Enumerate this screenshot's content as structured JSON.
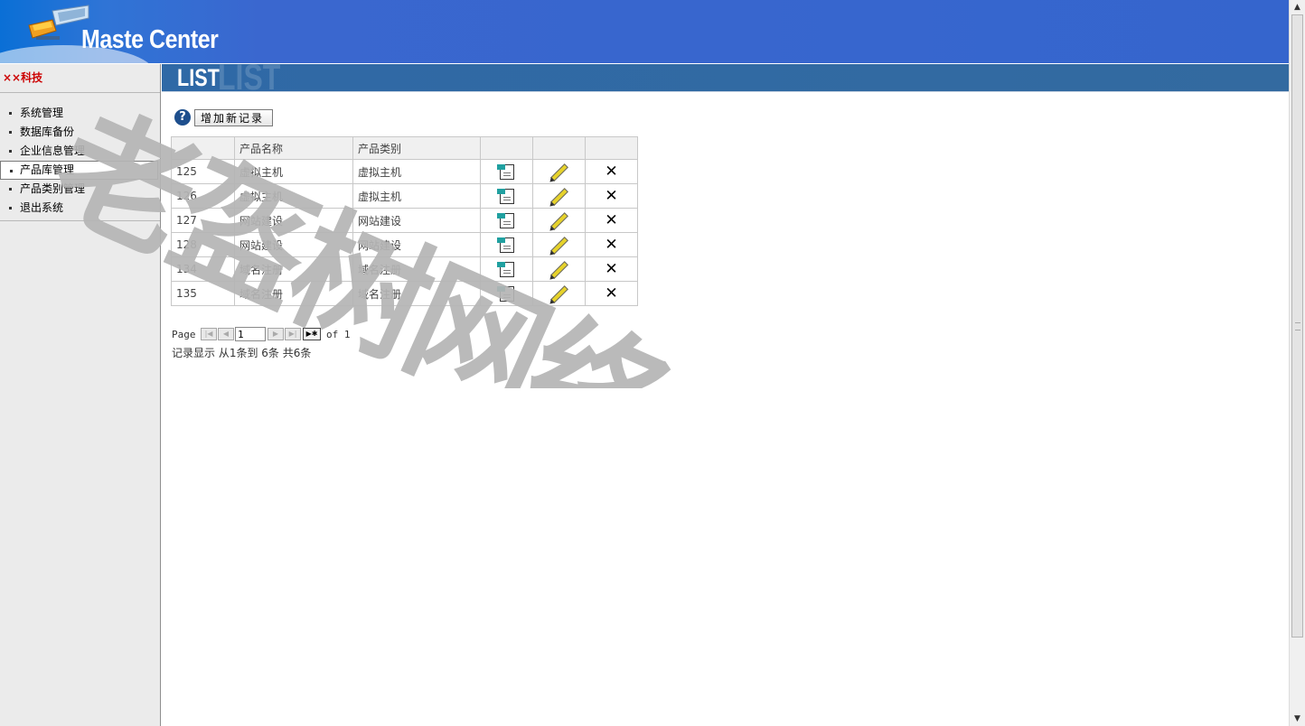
{
  "header": {
    "app_title": "Maste Center"
  },
  "sidebar": {
    "brand": "××科技",
    "items": [
      {
        "label": "系统管理",
        "active": false
      },
      {
        "label": "数据库备份",
        "active": false
      },
      {
        "label": "企业信息管理",
        "active": false
      },
      {
        "label": "产品库管理",
        "active": true
      },
      {
        "label": "产品类别管理",
        "active": false
      },
      {
        "label": "退出系统",
        "active": false
      }
    ]
  },
  "banner": {
    "title": "LIST",
    "ghost": "LIST"
  },
  "toolbar": {
    "add_label": "增加新记录",
    "add_icon": "?"
  },
  "table": {
    "columns": [
      "",
      "产品名称",
      "产品类别",
      "",
      "",
      ""
    ],
    "rows": [
      {
        "id": "125",
        "name": "虚拟主机",
        "category": "虚拟主机"
      },
      {
        "id": "126",
        "name": "虚拟主机",
        "category": "虚拟主机"
      },
      {
        "id": "127",
        "name": "网站建设",
        "category": "网站建设"
      },
      {
        "id": "128",
        "name": "网站建设",
        "category": "网站建设"
      },
      {
        "id": "134",
        "name": "域名注册",
        "category": "域名注册"
      },
      {
        "id": "135",
        "name": "域名注册",
        "category": "域名注册"
      }
    ],
    "row_icons": [
      "view-icon",
      "edit-icon",
      "delete-icon"
    ]
  },
  "pager": {
    "page_label": "Page",
    "current_page": "1",
    "of_label": "of 1",
    "first": "|◀",
    "prev": "◀",
    "next": "▶",
    "last": "▶|",
    "new": "▶✱"
  },
  "record_info": "记录显示 从1条到 6条 共6条",
  "watermark": {
    "text": "老盔树网络",
    "color": "#b4b4b4"
  },
  "colors": {
    "header_blue": "#3565cd",
    "banner_blue": "#336aa0",
    "brand_red": "#cc0000",
    "sidebar_bg": "#ebebeb"
  }
}
